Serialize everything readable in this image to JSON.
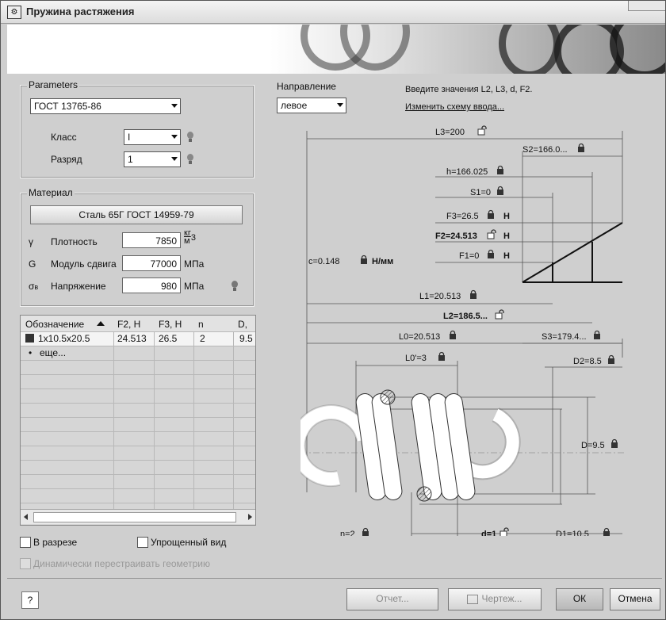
{
  "window": {
    "title": "Пружина растяжения"
  },
  "parameters": {
    "group_label": "Parameters",
    "standard": "ГОСТ 13765-86",
    "class_label": "Класс",
    "class_value": "I",
    "rank_label": "Разряд",
    "rank_value": "1"
  },
  "direction": {
    "label": "Направление",
    "value": "левое"
  },
  "hint": {
    "text": "Введите значения L2, L3, d, F2.",
    "link": "Изменить схему ввода..."
  },
  "material": {
    "group_label": "Материал",
    "button": "Сталь 65Г ГОСТ 14959-79",
    "density": {
      "symbol": "γ",
      "label": "Плотность",
      "value": "7850",
      "unit_top": "кг",
      "unit_bottom": "м",
      "unit_exp": "3"
    },
    "shear": {
      "symbol": "G",
      "label": "Модуль сдвига",
      "value": "77000",
      "unit": "МПа"
    },
    "stress": {
      "symbol": "σ",
      "symbol_sub": "в",
      "label": "Напряжение",
      "value": "980",
      "unit": "МПа"
    }
  },
  "table": {
    "columns": [
      "Обозначение",
      "F2, Н",
      "F3, Н",
      "n",
      "D, мм"
    ],
    "rows": [
      {
        "designation": "1x10.5x20.5",
        "f2": "24.513",
        "f3": "26.5",
        "n": "2",
        "d": "9.5"
      }
    ],
    "more": "еще..."
  },
  "options": {
    "section": "В разрезе",
    "simplified": "Упрощенный вид",
    "dynamic": "Динамически перестраивать геометрию"
  },
  "buttons": {
    "help": "?",
    "report": "Отчет...",
    "drawing": "Чертеж...",
    "ok": "ОК",
    "cancel": "Отмена"
  },
  "drawing": {
    "L3": "L3=200",
    "S2": "S2=166.0...",
    "h": "h=166.025",
    "S1": "S1=0",
    "F3": "F3=26.5",
    "F3_unit": "Н",
    "F2": "F2=24.513",
    "F2_unit": "Н",
    "F1": "F1=0",
    "F1_unit": "Н",
    "c": "c=0.148",
    "c_unit": "Н/мм",
    "L1": "L1=20.513",
    "L2": "L2=186.5...",
    "L0": "L0=20.513",
    "S3": "S3=179.4...",
    "L0p": "L0'=3",
    "D2": "D2=8.5",
    "D": "D=9.5",
    "n": "n=2",
    "d": "d=1",
    "D1": "D1=10.5"
  }
}
